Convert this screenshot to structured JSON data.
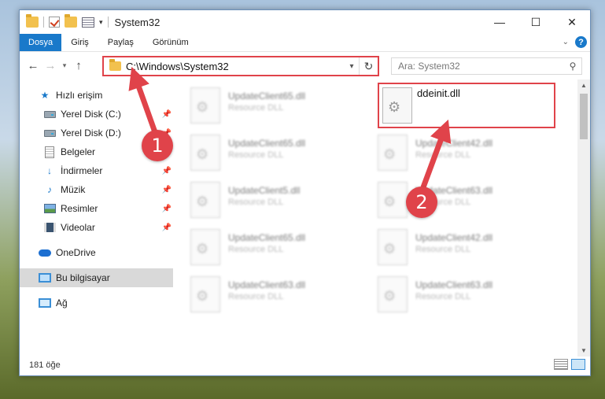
{
  "window": {
    "title": "System32",
    "controls": {
      "minimize": "—",
      "maximize": "☐",
      "close": "✕"
    }
  },
  "ribbon": {
    "tabs": [
      "Dosya",
      "Giriş",
      "Paylaş",
      "Görünüm"
    ],
    "help": "?"
  },
  "address": {
    "path": "C:\\Windows\\System32",
    "search_placeholder": "Ara: System32"
  },
  "sidebar": {
    "items": [
      {
        "label": "Hızlı erişim",
        "icon": "star-icon"
      },
      {
        "label": "Yerel Disk (C:)",
        "icon": "drive-icon",
        "pinned": true
      },
      {
        "label": "Yerel Disk (D:)",
        "icon": "drive-icon",
        "pinned": true
      },
      {
        "label": "Belgeler",
        "icon": "document-icon",
        "pinned": true
      },
      {
        "label": "İndirmeler",
        "icon": "download-icon",
        "pinned": true
      },
      {
        "label": "Müzik",
        "icon": "music-icon",
        "pinned": true
      },
      {
        "label": "Resimler",
        "icon": "pictures-icon",
        "pinned": true
      },
      {
        "label": "Videolar",
        "icon": "videos-icon",
        "pinned": true
      },
      {
        "label": "OneDrive",
        "icon": "onedrive-icon"
      },
      {
        "label": "Bu bilgisayar",
        "icon": "computer-icon",
        "selected": true
      },
      {
        "label": "Ağ",
        "icon": "network-icon"
      }
    ]
  },
  "files": [
    {
      "name": "UpdateClient65.dll",
      "type": "Resource DLL"
    },
    {
      "name": "ddeinit.dll",
      "type": ""
    },
    {
      "name": "UpdateClient65.dll",
      "type": "Resource DLL"
    },
    {
      "name": "UpdateClient42.dll",
      "type": "Resource DLL"
    },
    {
      "name": "UpdateClient5.dll",
      "type": "Resource DLL"
    },
    {
      "name": "UpdateClient63.dll",
      "type": "Resource DLL"
    },
    {
      "name": "UpdateClient65.dll",
      "type": "Resource DLL"
    },
    {
      "name": "UpdateClient42.dll",
      "type": "Resource DLL"
    },
    {
      "name": "UpdateClient63.dll",
      "type": "Resource DLL"
    },
    {
      "name": "UpdateClient63.dll",
      "type": "Resource DLL"
    }
  ],
  "status": {
    "count": "181 öğe"
  },
  "annotations": {
    "callout1": "1",
    "callout2": "2",
    "color": "#e0434a"
  }
}
